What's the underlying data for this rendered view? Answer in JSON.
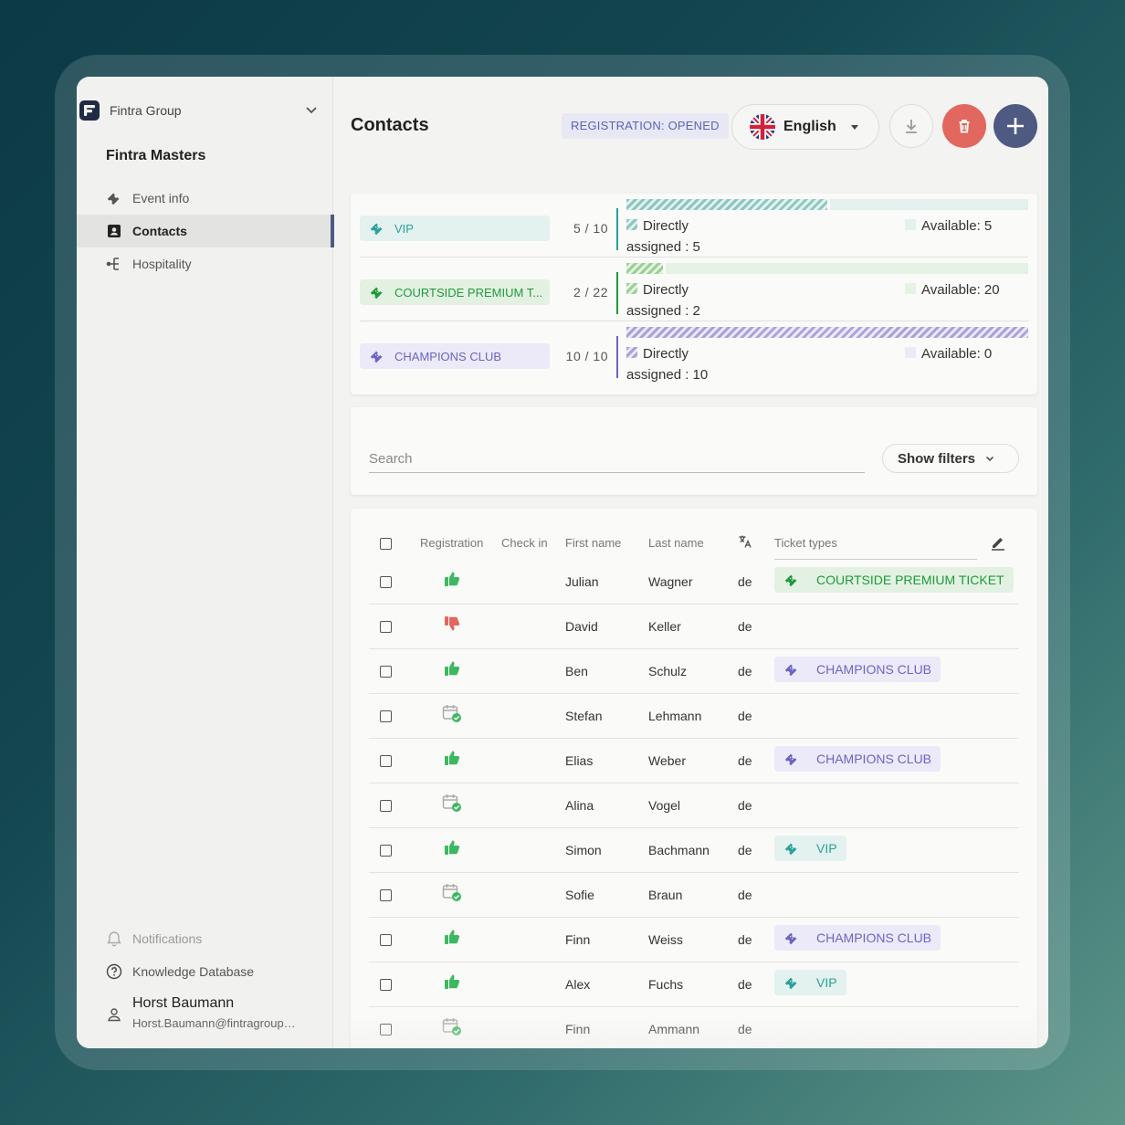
{
  "sidebar": {
    "org_name": "Fintra Group",
    "event_name": "Fintra Masters",
    "nav": [
      {
        "label": "Event info",
        "icon": "ticket-icon"
      },
      {
        "label": "Contacts",
        "icon": "contact-card-icon",
        "active": true
      },
      {
        "label": "Hospitality",
        "icon": "hierarchy-icon"
      }
    ],
    "bottom_nav": [
      {
        "label": "Notifications",
        "icon": "bell-icon"
      },
      {
        "label": "Knowledge Database",
        "icon": "help-circle-icon"
      }
    ],
    "user": {
      "name": "Horst Baumann",
      "email": "Horst.Baumann@fintragroup.com"
    }
  },
  "header": {
    "title": "Contacts",
    "registration_badge": "REGISTRATION: OPENED",
    "language": "English",
    "language_flag": "uk-flag-icon"
  },
  "tickets": [
    {
      "name": "VIP",
      "assigned": 5,
      "total": 10,
      "count_label": "5 / 10",
      "directly_label": "Directly",
      "assigned_label": "assigned : 5",
      "available_label": "Available: 5",
      "color": "#2aa198",
      "pill_bg": "#e3f1ef",
      "bar_color": "#8cc7c0",
      "rest_color": "#e3f1ef"
    },
    {
      "name": "COURTSIDE PREMIUM T...",
      "assigned": 2,
      "total": 22,
      "count_label": "2 / 22",
      "directly_label": "Directly",
      "assigned_label": "assigned : 2",
      "available_label": "Available: 20",
      "color": "#1f9a3b",
      "pill_bg": "#e3f1e2",
      "bar_color": "#9bd096",
      "rest_color": "#e6f3e4"
    },
    {
      "name": "CHAMPIONS CLUB",
      "assigned": 10,
      "total": 10,
      "count_label": "10 / 10",
      "directly_label": "Directly",
      "assigned_label": "assigned : 10",
      "available_label": "Available: 0",
      "color": "#6c64c4",
      "pill_bg": "#eceaf8",
      "bar_color": "#a9a3da",
      "rest_color": "#eceaf8"
    }
  ],
  "search": {
    "placeholder": "Search",
    "value": ""
  },
  "filters_label": "Show filters",
  "table": {
    "headers": {
      "registration": "Registration",
      "checkin": "Check in",
      "first_name": "First name",
      "last_name": "Last name",
      "language_icon": "translate-icon",
      "ticket_types": "Ticket types",
      "edit_icon": "pencil-icon"
    },
    "rows": [
      {
        "status": "thumbs-up",
        "first": "Julian",
        "last": "Wagner",
        "lang": "de",
        "ticket": "COURTSIDE PREMIUM TICKET",
        "ticket_kind": "courtside"
      },
      {
        "status": "thumbs-down",
        "first": "David",
        "last": "Keller",
        "lang": "de",
        "ticket": "",
        "ticket_kind": ""
      },
      {
        "status": "thumbs-up",
        "first": "Ben",
        "last": "Schulz",
        "lang": "de",
        "ticket": "CHAMPIONS CLUB",
        "ticket_kind": "champions"
      },
      {
        "status": "calendar-check",
        "first": "Stefan",
        "last": "Lehmann",
        "lang": "de",
        "ticket": "",
        "ticket_kind": ""
      },
      {
        "status": "thumbs-up",
        "first": "Elias",
        "last": "Weber",
        "lang": "de",
        "ticket": "CHAMPIONS CLUB",
        "ticket_kind": "champions"
      },
      {
        "status": "calendar-check",
        "first": "Alina",
        "last": "Vogel",
        "lang": "de",
        "ticket": "",
        "ticket_kind": ""
      },
      {
        "status": "thumbs-up",
        "first": "Simon",
        "last": "Bachmann",
        "lang": "de",
        "ticket": "VIP",
        "ticket_kind": "vip"
      },
      {
        "status": "calendar-check",
        "first": "Sofie",
        "last": "Braun",
        "lang": "de",
        "ticket": "",
        "ticket_kind": ""
      },
      {
        "status": "thumbs-up",
        "first": "Finn",
        "last": "Weiss",
        "lang": "de",
        "ticket": "CHAMPIONS CLUB",
        "ticket_kind": "champions"
      },
      {
        "status": "thumbs-up",
        "first": "Alex",
        "last": "Fuchs",
        "lang": "de",
        "ticket": "VIP",
        "ticket_kind": "vip"
      },
      {
        "status": "calendar-check",
        "first": "Finn",
        "last": "Ammann",
        "lang": "de",
        "ticket": "",
        "ticket_kind": ""
      }
    ]
  },
  "colors": {
    "accent": "#4f5a82",
    "danger": "#e2675f",
    "success": "#3cb862"
  }
}
